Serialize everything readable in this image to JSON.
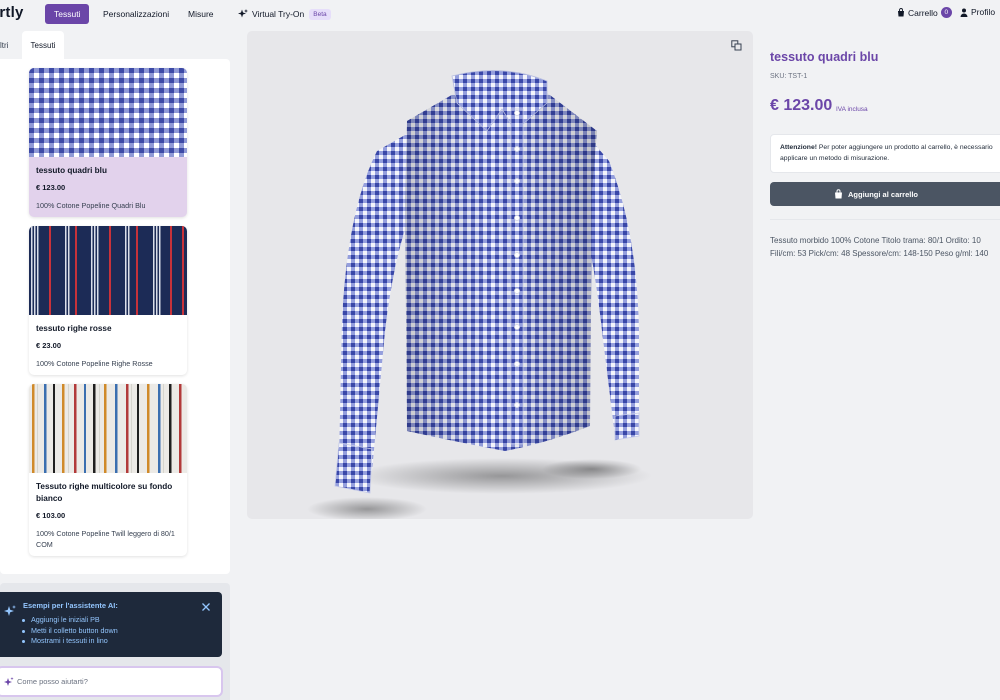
{
  "nav": {
    "brand": "irtly",
    "items": [
      {
        "label": "Tessuti",
        "active": true
      },
      {
        "label": "Personalizzazioni",
        "active": false
      },
      {
        "label": "Misure",
        "active": false
      },
      {
        "label": "Virtual Try-On",
        "active": false,
        "badge": "Beta"
      }
    ],
    "cart_label": "Carrello",
    "cart_count": "0",
    "profile_label": "Profilo"
  },
  "left": {
    "tabs": [
      {
        "label": "ltri",
        "active": false
      },
      {
        "label": "Tessuti",
        "active": true
      }
    ],
    "fabrics": [
      {
        "title": "tessuto quadri blu",
        "price": "€ 123.00",
        "desc": "100% Cotone Popeline Quadri Blu",
        "selected": true,
        "pattern": "gingham-blue"
      },
      {
        "title": "tessuto righe rosse",
        "price": "€ 23.00",
        "desc": "100% Cotone Popeline Righe Rosse",
        "selected": false,
        "pattern": "stripes-navy-red"
      },
      {
        "title": "Tessuto righe multicolore su fondo bianco",
        "price": "€ 103.00",
        "desc": "100% Cotone Popeline Twill leggero di 80/1 COM",
        "selected": false,
        "pattern": "stripes-multicolor"
      }
    ]
  },
  "assistant": {
    "heading": "Esempi per l'assistente AI:",
    "examples": [
      "Aggiungi le iniziali PB",
      "Metti il colletto button down",
      "Mostrami i tessuti in lino"
    ],
    "input_placeholder": "Come posso aiutarti?"
  },
  "product": {
    "title": "tessuto quadri blu",
    "sku": "SKU: TST-1",
    "price": "€ 123.00",
    "vat": "IVA inclusa",
    "notice_bold": "Attenzione!",
    "notice_text": " Per poter aggiungere un prodotto al carrello, è necessario applicare un metodo di misurazione.",
    "add_to_cart": "Aggiungi al carrello",
    "description_line1": "Tessuto morbido 100% Cotone Titolo trama: 80/1 Ordito: 10",
    "description_line2": "Fili/cm: 53 Pick/cm: 48 Spessore/cm: 148-150 Peso g/ml: 140"
  },
  "colors": {
    "accent": "#6b46a8",
    "selected_card": "#e2d2ec",
    "assistant_bg": "#1e293b",
    "button": "#4b5563"
  },
  "icons": [
    "sparkle-icon",
    "cart-icon",
    "user-icon",
    "compare-icon",
    "close-icon",
    "bag-icon"
  ]
}
